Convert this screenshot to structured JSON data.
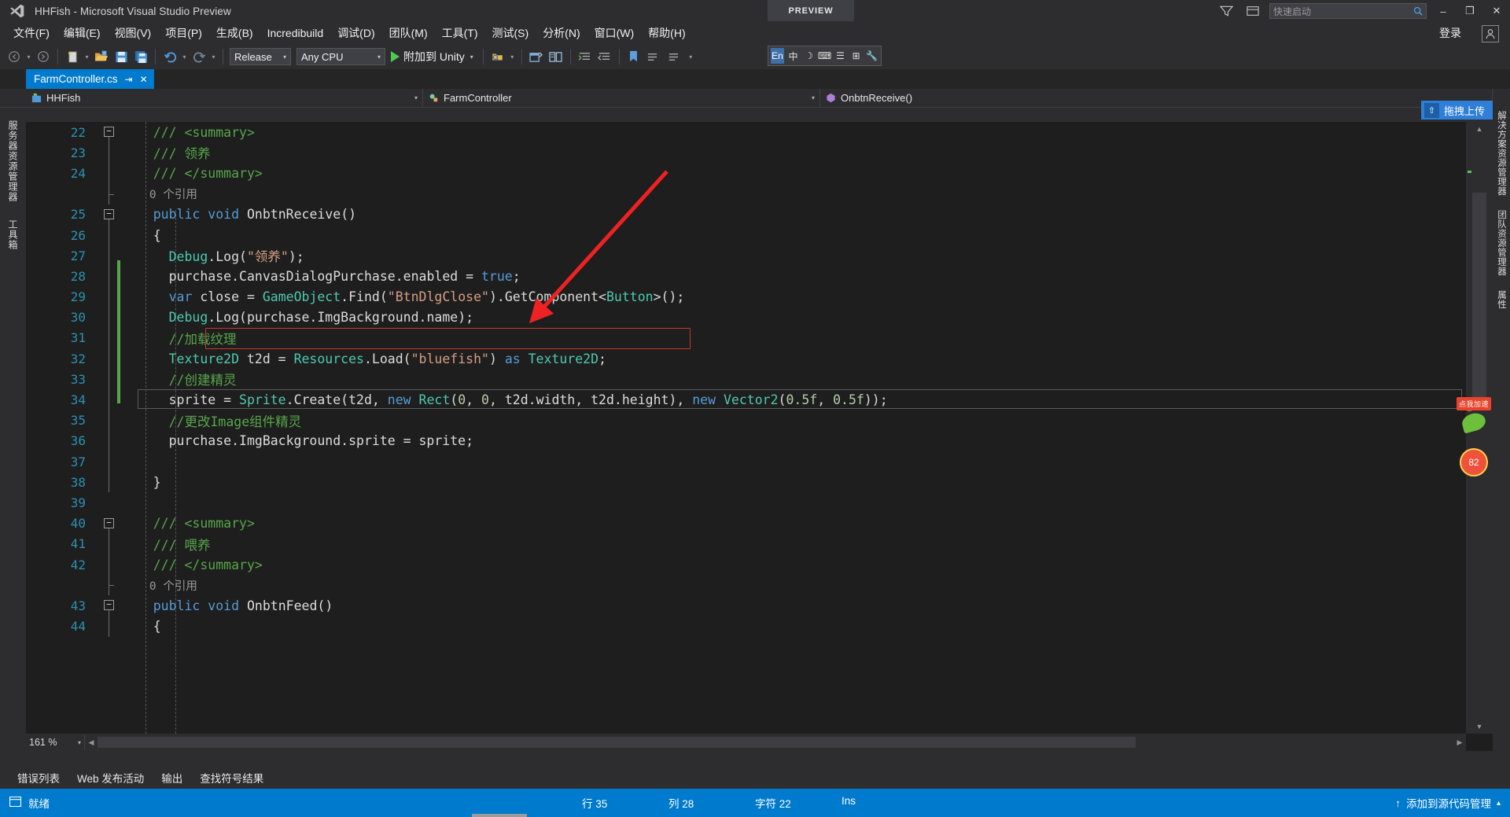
{
  "window": {
    "title": "HHFish - Microsoft Visual Studio Preview",
    "preview_badge": "PREVIEW",
    "logo_icon": "visual-studio-logo",
    "minimize_icon": "–",
    "maximize_icon": "❐",
    "close_icon": "✕",
    "feedback_icon": "▽",
    "notify_icon": "▤"
  },
  "quick_launch": {
    "placeholder": "快速启动",
    "search_icon": "search-icon"
  },
  "menu": {
    "items": [
      {
        "label": "文件(F)"
      },
      {
        "label": "编辑(E)"
      },
      {
        "label": "视图(V)"
      },
      {
        "label": "项目(P)"
      },
      {
        "label": "生成(B)"
      },
      {
        "label": "Incredibuild"
      },
      {
        "label": "调试(D)"
      },
      {
        "label": "团队(M)"
      },
      {
        "label": "工具(T)"
      },
      {
        "label": "测试(S)"
      },
      {
        "label": "分析(N)"
      },
      {
        "label": "窗口(W)"
      },
      {
        "label": "帮助(H)"
      }
    ],
    "signin_label": "登录",
    "account_icon": "account-icon"
  },
  "toolbar": {
    "nav_back_icon": "nav-back-icon",
    "nav_forward_icon": "nav-forward-icon",
    "new_project_icon": "new-project-icon",
    "open_file_icon": "open-file-icon",
    "save_icon": "save-icon",
    "save_all_icon": "save-all-icon",
    "undo_icon": "undo-icon",
    "redo_icon": "redo-icon",
    "config_value": "Release",
    "platform_value": "Any CPU",
    "run_label": "附加到 Unity",
    "run_icon": "play-icon",
    "find_in_files_icon": "find-in-files-icon",
    "window_icon": "window-icon",
    "compare_icon": "compare-icon",
    "indent1_icon": "indent-icon",
    "indent2_icon": "outdent-icon",
    "bookmark_icon": "bookmark-icon",
    "comment_icon": "comment-icon",
    "uncomment_icon": "uncomment-icon",
    "overflow_icon": "toolbar-overflow-icon"
  },
  "ime": {
    "cells": [
      "En",
      "中",
      "☽",
      "⌨",
      "☰",
      "⊞",
      "🔧"
    ]
  },
  "document_tab": {
    "name": "FarmController.cs",
    "pin_icon": "pin-icon",
    "close_icon": "close-icon"
  },
  "navbar": {
    "project": "HHFish",
    "project_icon": "project-icon",
    "type": "FarmController",
    "type_icon": "class-icon",
    "member": "OnbtnReceive()",
    "member_icon": "method-icon",
    "caret_icon": "chevron-down-icon"
  },
  "left_dock": {
    "items": [
      {
        "label": "服务器资源管理器"
      },
      {
        "label": "工具箱"
      }
    ]
  },
  "right_dock": {
    "items": [
      {
        "label": "解决方案资源管理器"
      },
      {
        "label": "团队资源管理器"
      },
      {
        "label": "属性"
      }
    ]
  },
  "upload_widget": {
    "label": "拖拽上传",
    "icon": "upload-icon"
  },
  "ad_widget": {
    "label": "点我加速",
    "badge": "82"
  },
  "editor": {
    "zoom": "161 %",
    "zoom_caret_icon": "chevron-down-icon",
    "first_line": 22,
    "lines": [
      {
        "num": "22",
        "indent": 2,
        "fold": "minus",
        "tokens": [
          [
            "c",
            "/// <summary>"
          ]
        ]
      },
      {
        "num": "23",
        "indent": 2,
        "fold": "bar",
        "tokens": [
          [
            "c",
            "/// "
          ],
          [
            "c",
            "领养"
          ]
        ]
      },
      {
        "num": "24",
        "indent": 2,
        "fold": "bar",
        "tokens": [
          [
            "c",
            "/// </summary>"
          ]
        ]
      },
      {
        "num": "",
        "indent": 2,
        "fold": "tick",
        "tokens": [
          [
            "cr",
            "0 个引用"
          ]
        ],
        "codelens": true
      },
      {
        "num": "25",
        "indent": 2,
        "fold": "minus",
        "tokens": [
          [
            "k",
            "public"
          ],
          [
            "p",
            " "
          ],
          [
            "k",
            "void"
          ],
          [
            "p",
            " "
          ],
          [
            "cl",
            "OnbtnReceive()"
          ]
        ]
      },
      {
        "num": "26",
        "indent": 2,
        "fold": "bar",
        "tokens": [
          [
            "p",
            "{"
          ]
        ]
      },
      {
        "num": "27",
        "indent": 3,
        "fold": "bar",
        "tokens": [
          [
            "t",
            "Debug"
          ],
          [
            "p",
            "."
          ],
          [
            "cl",
            "Log"
          ],
          [
            "p",
            "("
          ],
          [
            "s",
            "\"领养\""
          ],
          [
            "p",
            ");"
          ]
        ]
      },
      {
        "num": "28",
        "indent": 3,
        "fold": "bar",
        "tokens": [
          [
            "p",
            "purchase"
          ],
          [
            "p",
            "."
          ],
          [
            "p",
            "CanvasDialogPurchase"
          ],
          [
            "p",
            "."
          ],
          [
            "p",
            "enabled = "
          ],
          [
            "k",
            "true"
          ],
          [
            "p",
            ";"
          ]
        ]
      },
      {
        "num": "29",
        "indent": 3,
        "fold": "bar",
        "tokens": [
          [
            "k",
            "var"
          ],
          [
            "p",
            " close = "
          ],
          [
            "t",
            "GameObject"
          ],
          [
            "p",
            "."
          ],
          [
            "cl",
            "Find"
          ],
          [
            "p",
            "("
          ],
          [
            "s",
            "\"BtnDlgClose\""
          ],
          [
            "p",
            ")."
          ],
          [
            "cl",
            "GetComponent"
          ],
          [
            "p",
            "<"
          ],
          [
            "t",
            "Button"
          ],
          [
            "p",
            ">();"
          ]
        ],
        "changed": true
      },
      {
        "num": "30",
        "indent": 3,
        "fold": "bar",
        "tokens": [
          [
            "t",
            "Debug"
          ],
          [
            "p",
            "."
          ],
          [
            "cl",
            "Log"
          ],
          [
            "p",
            "(purchase."
          ],
          [
            "p",
            "ImgBackground"
          ],
          [
            "p",
            "."
          ],
          [
            "p",
            "name);"
          ]
        ],
        "changed": true
      },
      {
        "num": "31",
        "indent": 3,
        "fold": "bar",
        "tokens": [
          [
            "c",
            "//加载纹理"
          ]
        ],
        "changed": true
      },
      {
        "num": "32",
        "indent": 3,
        "fold": "bar",
        "tokens": [
          [
            "t",
            "Texture2D"
          ],
          [
            "p",
            " t2d = "
          ],
          [
            "t",
            "Resources"
          ],
          [
            "p",
            "."
          ],
          [
            "cl",
            "Load"
          ],
          [
            "p",
            "("
          ],
          [
            "s",
            "\"bluefish\""
          ],
          [
            "p",
            ") "
          ],
          [
            "k",
            "as"
          ],
          [
            "p",
            " "
          ],
          [
            "t",
            "Texture2D"
          ],
          [
            "p",
            ";"
          ]
        ],
        "changed": true,
        "highlight": true
      },
      {
        "num": "33",
        "indent": 3,
        "fold": "bar",
        "tokens": [
          [
            "c",
            "//创建精灵"
          ]
        ],
        "changed": true
      },
      {
        "num": "34",
        "indent": 3,
        "fold": "bar",
        "tokens": [
          [
            "p",
            "sprite = "
          ],
          [
            "t",
            "Sprite"
          ],
          [
            "p",
            "."
          ],
          [
            "cl",
            "Create"
          ],
          [
            "p",
            "(t2d, "
          ],
          [
            "k",
            "new"
          ],
          [
            "p",
            " "
          ],
          [
            "t",
            "Rect"
          ],
          [
            "p",
            "("
          ],
          [
            "n",
            "0"
          ],
          [
            "p",
            ", "
          ],
          [
            "n",
            "0"
          ],
          [
            "p",
            ", t2d.width, t2d.height), "
          ],
          [
            "k",
            "new"
          ],
          [
            "p",
            " "
          ],
          [
            "t",
            "Vector2"
          ],
          [
            "p",
            "("
          ],
          [
            "n",
            "0.5f"
          ],
          [
            "p",
            ", "
          ],
          [
            "n",
            "0.5f"
          ],
          [
            "p",
            "));"
          ]
        ],
        "changed": true
      },
      {
        "num": "35",
        "indent": 3,
        "fold": "bar",
        "tokens": [
          [
            "c",
            "//更改Image组件精灵"
          ]
        ],
        "changed": true,
        "current": true
      },
      {
        "num": "36",
        "indent": 3,
        "fold": "bar",
        "tokens": [
          [
            "p",
            "purchase."
          ],
          [
            "p",
            "ImgBackground"
          ],
          [
            "p",
            "."
          ],
          [
            "p",
            "sprite = sprite;"
          ]
        ]
      },
      {
        "num": "37",
        "indent": 3,
        "fold": "bar",
        "tokens": []
      },
      {
        "num": "38",
        "indent": 2,
        "fold": "bar",
        "tokens": [
          [
            "p",
            "}"
          ]
        ]
      },
      {
        "num": "39",
        "indent": 2,
        "fold": "none",
        "tokens": []
      },
      {
        "num": "40",
        "indent": 2,
        "fold": "minus",
        "tokens": [
          [
            "c",
            "/// <summary>"
          ]
        ]
      },
      {
        "num": "41",
        "indent": 2,
        "fold": "bar",
        "tokens": [
          [
            "c",
            "/// "
          ],
          [
            "c",
            "喂养"
          ]
        ]
      },
      {
        "num": "42",
        "indent": 2,
        "fold": "bar",
        "tokens": [
          [
            "c",
            "/// </summary>"
          ]
        ]
      },
      {
        "num": "",
        "indent": 2,
        "fold": "tick",
        "tokens": [
          [
            "cr",
            "0 个引用"
          ]
        ],
        "codelens": true
      },
      {
        "num": "43",
        "indent": 2,
        "fold": "minus",
        "tokens": [
          [
            "k",
            "public"
          ],
          [
            "p",
            " "
          ],
          [
            "k",
            "void"
          ],
          [
            "p",
            " "
          ],
          [
            "cl",
            "OnbtnFeed()"
          ]
        ]
      },
      {
        "num": "44",
        "indent": 2,
        "fold": "bar",
        "tokens": [
          [
            "p",
            "{"
          ]
        ]
      }
    ]
  },
  "output_tabs": [
    {
      "label": "错误列表"
    },
    {
      "label": "Web 发布活动"
    },
    {
      "label": "输出"
    },
    {
      "label": "查找符号结果"
    }
  ],
  "status": {
    "ready": "就绪",
    "ready_icon": "ready-icon",
    "line_label": "行 35",
    "col_label": "列 28",
    "char_label": "字符 22",
    "insert_label": "Ins",
    "source_control": "添加到源代码管理",
    "source_control_icon": "up-arrow-icon",
    "source_control_caret": "chevron-up-icon"
  },
  "colors": {
    "accent": "#007acc",
    "chrome": "#2d2d30",
    "editor_bg": "#1e1e1e",
    "highlight_box": "#c0392b",
    "arrow": "#ee2222"
  }
}
